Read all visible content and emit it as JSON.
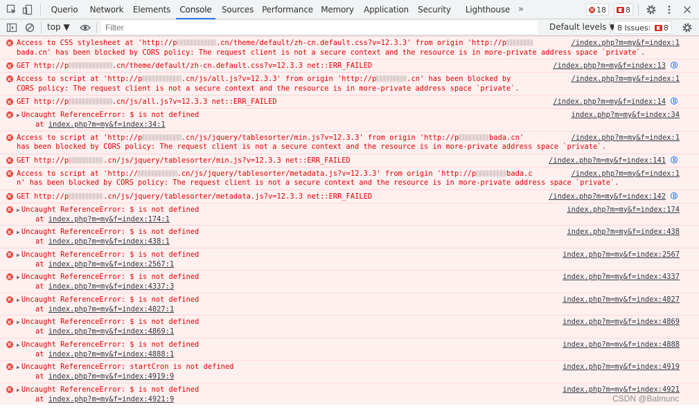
{
  "tabs": [
    "Querio",
    "Network",
    "Elements",
    "Console",
    "Sources",
    "Performance",
    "Memory",
    "Application",
    "Security",
    "Lighthouse"
  ],
  "active_tab": "Console",
  "more_tabs": "»",
  "error_count": "18",
  "issue_count": "8",
  "context": "top ▼",
  "filter_placeholder": "Filter",
  "levels": "Default levels ▼",
  "issues_label": "8 Issues:",
  "issues_badge": "8",
  "messages": [
    {
      "kind": "cors",
      "parts": [
        "Access to CSS stylesheet at '",
        "http://p",
        "",
        ".cn/theme/default/zh-cn.default.css?v=12.3.3",
        "' from origin '",
        "http://p",
        "",
        "",
        "bada.cn",
        "' has been blocked by CORS policy: The request client is not a secure context and the resource is in more-private address space `private`."
      ],
      "line1": "Access to CSS stylesheet at 'http://p█████████.cn/theme/default/zh-cn.default.css?v=12.3.3' from origin 'http://p██████",
      "line2": "bada.cn' has been blocked by CORS policy: The request client is not a secure context and the resource is in more-private address space `private`.",
      "source": "/index.php?m=my&f=index:1"
    },
    {
      "kind": "get",
      "line1": "GET http://p██████████.cn/theme/default/zh-cn.default.css?v=12.3.3 net::ERR_FAILED",
      "source": "/index.php?m=my&f=index:13"
    },
    {
      "kind": "cors",
      "line1": "Access to script at 'http://p█████████.cn/js/all.js?v=12.3.3' from origin 'http://p███████.cn' has been blocked by",
      "line2": "CORS policy: The request client is not a secure context and the resource is in more-private address space `private`.",
      "source": "/index.php?m=my&f=index:1"
    },
    {
      "kind": "get",
      "line1": "GET http://p██████████.cn/js/all.js?v=12.3.3 net::ERR_FAILED",
      "source": "/index.php?m=my&f=index:14"
    },
    {
      "kind": "ref",
      "line1": "Uncaught ReferenceError: $ is not defined",
      "at": "at ",
      "trace": "index.php?m=my&f=index:34:1",
      "source": "index.php?m=my&f=index:34"
    },
    {
      "kind": "cors",
      "line1": "Access to script at 'http://p█████████.cn/js/jquery/tablesorter/min.js?v=12.3.3' from origin 'http://p███████bada.cn'",
      "line2": "has been blocked by CORS policy: The request client is not a secure context and the resource is in more-private address space `private`.",
      "source": "/index.php?m=my&f=index:1"
    },
    {
      "kind": "get",
      "line1": "GET http://p████████.cn/js/jquery/tablesorter/min.js?v=12.3.3 net::ERR_FAILED",
      "source": "/index.php?m=my&f=index:141"
    },
    {
      "kind": "cors",
      "line1": "Access to script at 'http://█████████.cn/js/jquery/tablesorter/metadata.js?v=12.3.3' from origin 'http://p███████bada.c",
      "line2": "n' has been blocked by CORS policy: The request client is not a secure context and the resource is in more-private address space `private`.",
      "source": "/index.php?m=my&f=index:1"
    },
    {
      "kind": "get",
      "line1": "GET http://p████████.cn/js/jquery/tablesorter/metadata.js?v=12.3.3 net::ERR_FAILED",
      "source": "/index.php?m=my&f=index:142"
    },
    {
      "kind": "ref",
      "line1": "Uncaught ReferenceError: $ is not defined",
      "at": "at ",
      "trace": "index.php?m=my&f=index:174:1",
      "source": "index.php?m=my&f=index:174"
    },
    {
      "kind": "ref",
      "line1": "Uncaught ReferenceError: $ is not defined",
      "at": "at ",
      "trace": "index.php?m=my&f=index:438:1",
      "source": "index.php?m=my&f=index:438"
    },
    {
      "kind": "ref",
      "line1": "Uncaught ReferenceError: $ is not defined",
      "at": "at ",
      "trace": "index.php?m=my&f=index:2567:1",
      "source": "index.php?m=my&f=index:2567"
    },
    {
      "kind": "ref",
      "line1": "Uncaught ReferenceError: $ is not defined",
      "at": "at ",
      "trace": "index.php?m=my&f=index:4337:3",
      "source": "index.php?m=my&f=index:4337"
    },
    {
      "kind": "ref",
      "line1": "Uncaught ReferenceError: $ is not defined",
      "at": "at ",
      "trace": "index.php?m=my&f=index:4827:1",
      "source": "index.php?m=my&f=index:4827"
    },
    {
      "kind": "ref",
      "line1": "Uncaught ReferenceError: $ is not defined",
      "at": "at ",
      "trace": "index.php?m=my&f=index:4869:1",
      "source": "index.php?m=my&f=index:4869"
    },
    {
      "kind": "ref",
      "line1": "Uncaught ReferenceError: $ is not defined",
      "at": "at ",
      "trace": "index.php?m=my&f=index:4888:1",
      "source": "index.php?m=my&f=index:4888"
    },
    {
      "kind": "ref",
      "line1": "Uncaught ReferenceError: startCron is not defined",
      "at": "at ",
      "trace": "index.php?m=my&f=index:4919:9",
      "source": "index.php?m=my&f=index:4919"
    },
    {
      "kind": "ref",
      "line1": "Uncaught ReferenceError: $ is not defined",
      "at": "at ",
      "trace": "index.php?m=my&f=index:4921:9",
      "source": "index.php?m=my&f=index:4921"
    }
  ],
  "watermark": "CSDN @Balmunc",
  "colors": {
    "error_text": "#e00000",
    "row_bg": "#fff0f0",
    "row_border": "#ffd6d6",
    "accent": "#1a73e8"
  }
}
